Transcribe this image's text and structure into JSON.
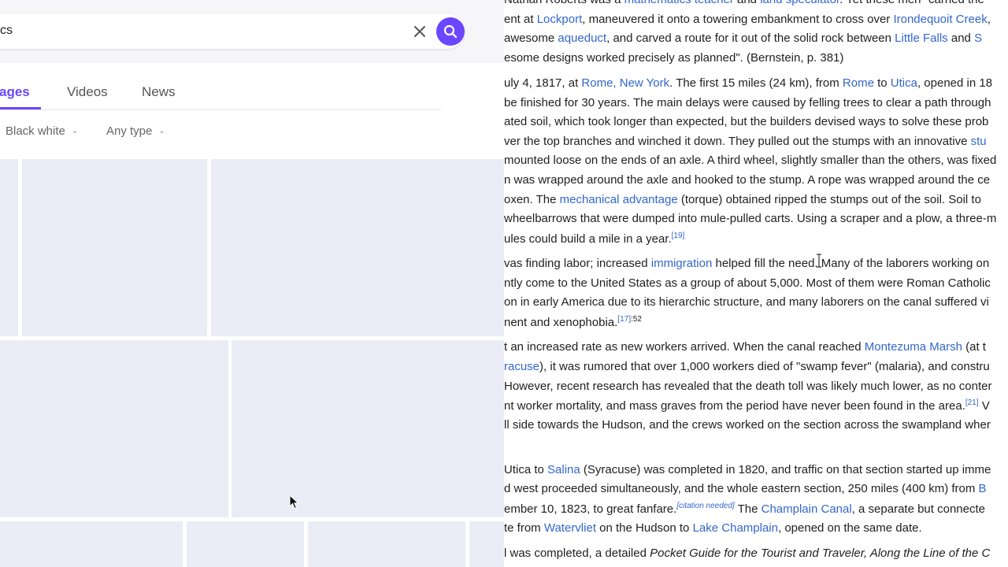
{
  "search": {
    "query": "cs"
  },
  "tabs": {
    "images": "ages",
    "videos": "Videos",
    "news": "News"
  },
  "filters": {
    "color": "Black white",
    "type": "Any type"
  },
  "colors": {
    "accent": "#6b46ff",
    "link": "#3366cc",
    "tile": "#ececf6"
  },
  "article": {
    "l1": {
      "a": "Nathan Roberts was a ",
      "b": "mathematics teacher",
      "c": " and ",
      "d": "land speculator",
      "e": ". Yet these men \"carried the"
    },
    "l2": {
      "a": "ent at ",
      "b": "Lockport",
      "c": ", maneuvered it onto a towering embankment to cross over ",
      "d": "Irondequoit Creek",
      "e": ","
    },
    "l3": {
      "a": "awesome ",
      "b": "aqueduct",
      "c": ", and carved a route for it out of the solid rock between ",
      "d": "Little Falls",
      "e": " and ",
      "f": "S"
    },
    "l4": "esome designs worked precisely as planned\". (Bernstein, p. 381)",
    "l5": {
      "a": "uly 4, 1817, at ",
      "b": "Rome, New York",
      "c": ". The first 15 miles (24 km), from ",
      "d": "Rome",
      "e": " to ",
      "f": "Utica",
      "g": ", opened in 18"
    },
    "l6": "be finished for 30 years. The main delays were caused by felling trees to clear a path through",
    "l7": "ated soil, which took longer than expected, but the builders devised ways to solve these prob",
    "l8": {
      "a": "ver the top branches and winched it down. They pulled out the stumps with an innovative ",
      "b": "stu"
    },
    "l9": "mounted loose on the ends of an axle. A third wheel, slightly smaller than the others, was fixed",
    "l10": "n was wrapped around the axle and hooked to the stump. A rope was wrapped around the ce",
    "l11": {
      "a": "oxen. The ",
      "b": "mechanical advantage",
      "c": " (torque) obtained ripped the stumps out of the soil. Soil to "
    },
    "l12": "wheelbarrows that were dumped into mule-pulled carts. Using a scraper and a plow, a three-m",
    "l13": {
      "a": "ules could build a mile in a year.",
      "ref": "[19]"
    },
    "l14": {
      "a": "vas finding labor; increased ",
      "b": "immigration",
      "c": " helped fill the need. Many of the laborers working on"
    },
    "l15": "ntly come to the United States as a group of about 5,000. Most of them were Roman Catholic",
    "l16": "on in early America due to its hierarchic structure, and many laborers on the canal suffered vi",
    "l17": {
      "a": "nent and xenophobia.",
      "ref": "[17]",
      "page": ":52"
    },
    "l18": {
      "a": "t an increased rate as new workers arrived. When the canal reached ",
      "b": "Montezuma Marsh",
      "c": " (at t"
    },
    "l19": {
      "a": "racuse",
      "b": "), it was rumored that over 1,000 workers died of \"swamp fever\" (malaria), and constru"
    },
    "l20": "However, recent research has revealed that the death toll was likely much lower, as no conter",
    "l21": {
      "a": "nt worker mortality, and mass graves from the period have never been found in the area.",
      "ref": "[21]",
      "b": " V"
    },
    "l22": "ll side towards the Hudson, and the crews worked on the section across the swampland wher",
    "l23": {
      "a": "Utica to ",
      "b": "Salina",
      "c": " (Syracuse) was completed in 1820, and traffic on that section started up imme"
    },
    "l24": {
      "a": "d west proceeded simultaneously, and the whole eastern section, 250 miles (400 km) from ",
      "b": "B"
    },
    "l25": {
      "a": "ember 10, 1823, to great fanfare.",
      "ref": "[citation needed]",
      "b": " The ",
      "c": "Champlain Canal",
      "d": ", a separate but connecte"
    },
    "l26": {
      "a": "te from ",
      "b": "Watervliet",
      "c": " on the Hudson to ",
      "d": "Lake Champlain",
      "e": ", opened on the same date."
    },
    "l27": {
      "a": "l was completed, a detailed ",
      "b": "Pocket Guide for the Tourist and Traveler, Along the Line of the C"
    }
  }
}
